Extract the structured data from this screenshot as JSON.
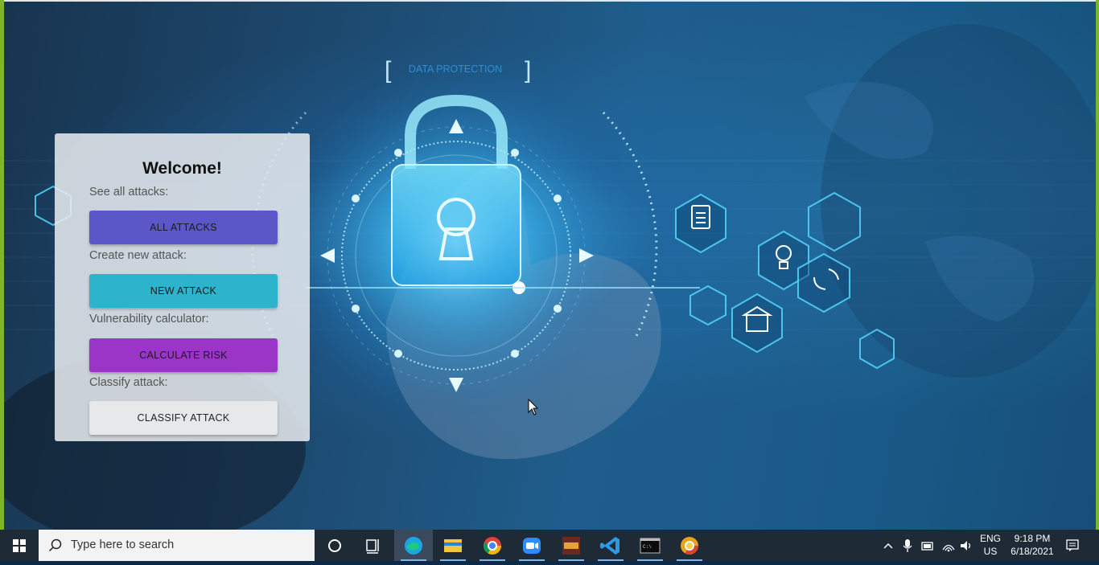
{
  "hero": {
    "banner_text": "DATA PROTECTION"
  },
  "welcome_card": {
    "title": "Welcome!",
    "sections": [
      {
        "label": "See all attacks:",
        "button": "ALL ATTACKS",
        "color": "#5b57c9"
      },
      {
        "label": "Create new attack:",
        "button": "NEW ATTACK",
        "color": "#2eb3cd"
      },
      {
        "label": "Vulnerability calculator:",
        "button": "CALCULATE RISK",
        "color": "#9a35c7"
      },
      {
        "label": "Classify attack:",
        "button": "CLASSIFY ATTACK",
        "color": "#e7e8ea"
      }
    ]
  },
  "taskbar": {
    "search_placeholder": "Type here to search",
    "pinned_apps": [
      "cortana-icon",
      "task-view-icon",
      "edge-icon",
      "file-explorer-icon",
      "chrome-icon",
      "zoom-icon",
      "game-app-icon",
      "vscode-icon",
      "terminal-icon",
      "chrome-canary-icon"
    ],
    "tray": {
      "language_primary": "ENG",
      "language_secondary": "US",
      "time": "9:18 PM",
      "date": "6/18/2021"
    }
  },
  "colors": {
    "accent_green_edge": "#7fb52c",
    "taskbar_bg": "#1e2a36"
  }
}
